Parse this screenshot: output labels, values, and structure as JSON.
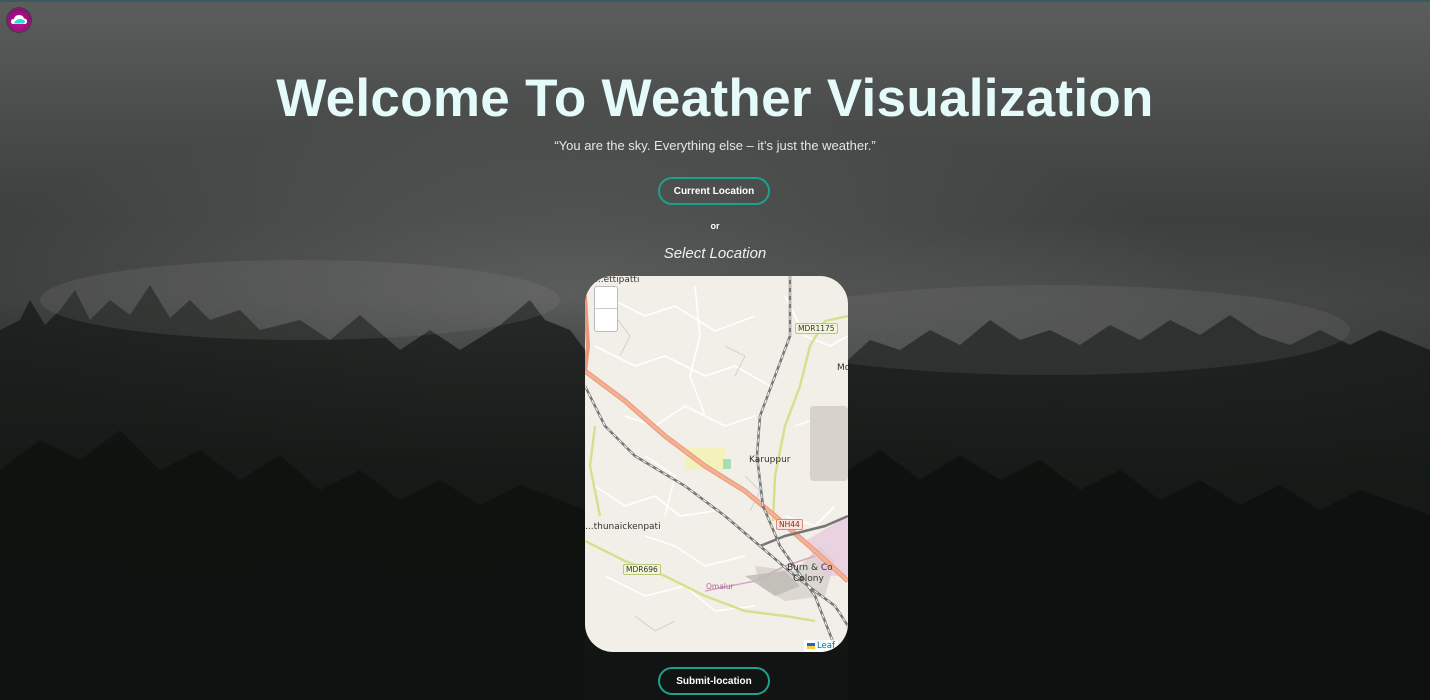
{
  "page": {
    "title": "Welcome To Weather Visualization",
    "quote": "“You are the sky. Everything else – it’s just the weather.”",
    "current_location_label": "Current Location",
    "or_label": "or",
    "select_location_label": "Select Location",
    "submit_label": "Submit-location"
  },
  "logo": {
    "icon": "cloud-logo-icon"
  },
  "map": {
    "places": {
      "top_left": "...ettipatti",
      "karuppur": "Karuppur",
      "left_mid": "...thunaickenpati",
      "burn_co": "Burn & Co",
      "colony": "Colony",
      "omalur": "Omalur",
      "right_edge": "Mo"
    },
    "road_badges": {
      "mdr1175": "MDR1175",
      "nh44": "NH44",
      "mdr696": "MDR696"
    },
    "zoom_in_icon": "zoom-in-icon",
    "zoom_out_icon": "zoom-out-icon",
    "attribution": "Leaf"
  },
  "colors": {
    "title": "#e4fbfa",
    "button_border": "#1ea08f",
    "logo": "#c3158f"
  }
}
